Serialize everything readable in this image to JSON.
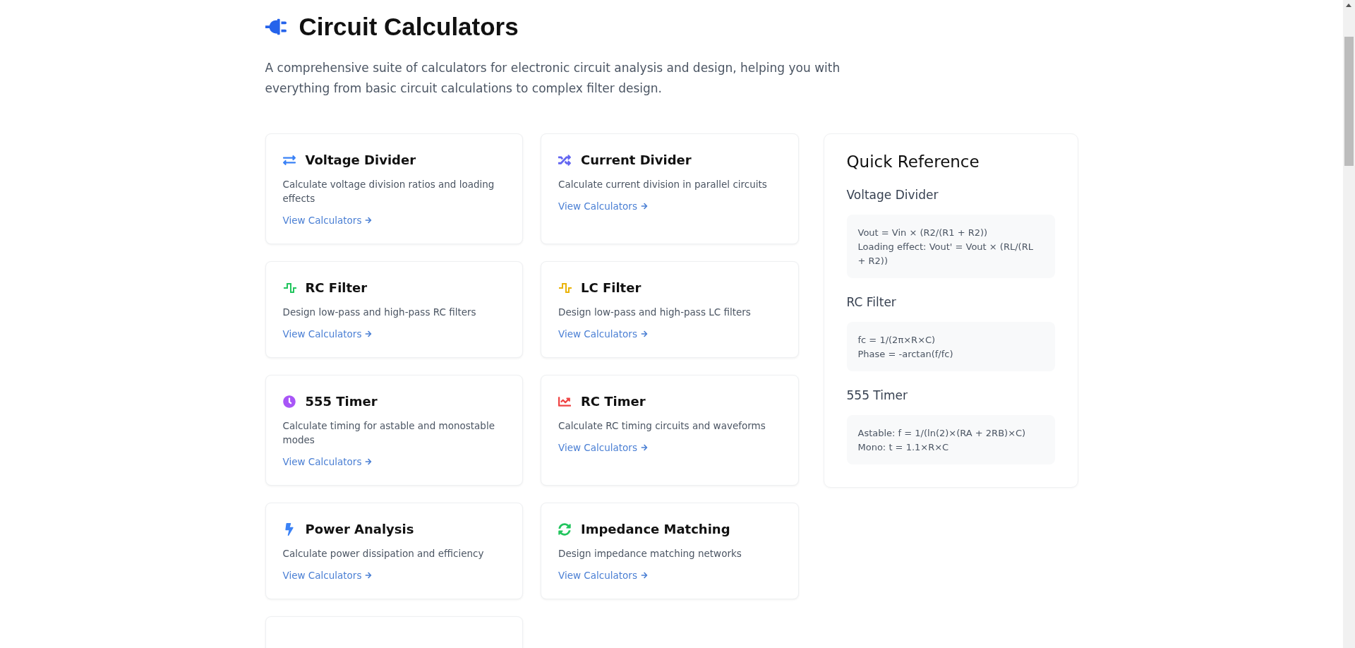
{
  "header": {
    "title": "Circuit Calculators",
    "description": "A comprehensive suite of calculators for electronic circuit analysis and design, helping you with everything from basic circuit calculations to complex filter design."
  },
  "cards": [
    {
      "kind": "exchange",
      "color": "#3b82f6",
      "title": "Voltage Divider",
      "description": "Calculate voltage division ratios and loading effects",
      "link": "View Calculators"
    },
    {
      "kind": "shuffle",
      "color": "#6366f1",
      "title": "Current Divider",
      "description": "Calculate current division in parallel circuits",
      "link": "View Calculators"
    },
    {
      "kind": "wave",
      "color": "#22c55e",
      "title": "RC Filter",
      "description": "Design low-pass and high-pass RC filters",
      "link": "View Calculators"
    },
    {
      "kind": "wave",
      "color": "#eab308",
      "title": "LC Filter",
      "description": "Design low-pass and high-pass LC filters",
      "link": "View Calculators"
    },
    {
      "kind": "clock",
      "color": "#a855f7",
      "title": "555 Timer",
      "description": "Calculate timing for astable and monostable modes",
      "link": "View Calculators"
    },
    {
      "kind": "chart",
      "color": "#ef4444",
      "title": "RC Timer",
      "description": "Calculate RC timing circuits and waveforms",
      "link": "View Calculators"
    },
    {
      "kind": "bolt",
      "color": "#3b82f6",
      "title": "Power Analysis",
      "description": "Calculate power dissipation and efficiency",
      "link": "View Calculators"
    },
    {
      "kind": "sync",
      "color": "#22c55e",
      "title": "Impedance Matching",
      "description": "Design impedance matching networks",
      "link": "View Calculators"
    }
  ],
  "quick_reference": {
    "title": "Quick Reference",
    "sections": [
      {
        "title": "Voltage Divider",
        "lines": [
          "Vout = Vin × (R2/(R1 + R2))",
          "Loading effect: Vout' = Vout × (RL/(RL + R2))"
        ]
      },
      {
        "title": "RC Filter",
        "lines": [
          "fc = 1/(2π×R×C)",
          "Phase = -arctan(f/fc)"
        ]
      },
      {
        "title": "555 Timer",
        "lines": [
          "Astable: f = 1/(ln(2)×(RA + 2RB)×C)",
          "Mono: t = 1.1×R×C"
        ]
      }
    ]
  }
}
